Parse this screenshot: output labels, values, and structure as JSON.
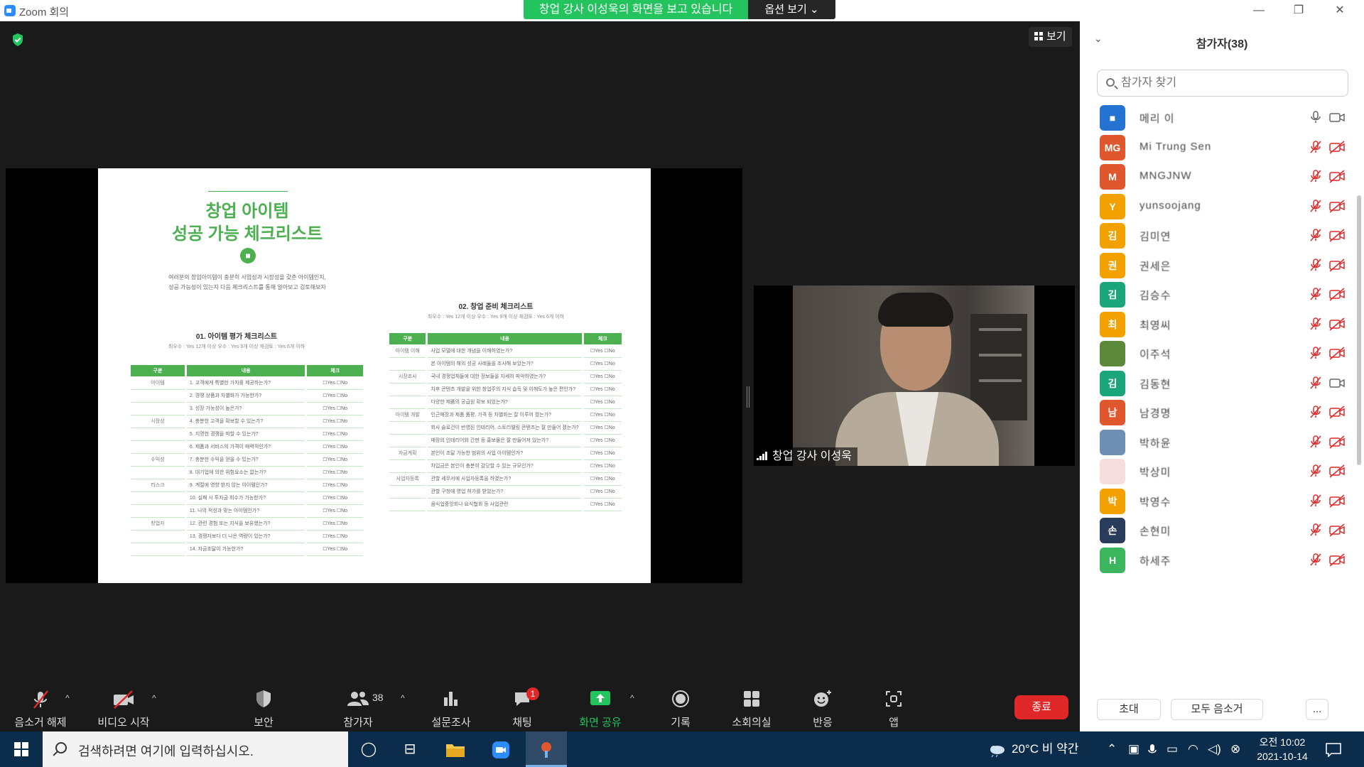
{
  "window": {
    "title": "Zoom 회의",
    "sharing_banner": "창업 강사 이성욱의 화면을 보고 있습니다",
    "options_label": "옵션 보기 ⌄",
    "minimize": "—",
    "restore": "❐",
    "close": "✕"
  },
  "view": {
    "label": "보기"
  },
  "slide": {
    "title_line1": "창업 아이템",
    "title_line2": "성공 가능 체크리스트",
    "intro_line1": "여러분의 창업아이템이 충분히 사업성과 시장성을 갖춘 아이템인지,",
    "intro_line2": "성공 가능성이 있는지 다음 체크리스트를 통해 알아보고 검토해보자",
    "section1_title": "01. 아이템 평가 체크리스트",
    "section1_sub": "최우수 : Yes 12개 이상   우수 : Yes 9개 이상   재검토 : Yes 6개 이하",
    "section2_title": "02. 창업 준비 체크리스트",
    "section2_sub": "최우수 : Yes 12개 이상   우수 : Yes 9개 이상   재검토 : Yes 6개 이하",
    "headers": [
      "구분",
      "내용",
      "체크"
    ],
    "check_text": "☐Yes  ☐No",
    "table1": [
      {
        "cat": "아이템",
        "text": "1. 고객에게 특별한 가치를 제공하는가?"
      },
      {
        "cat": "",
        "text": "2. 경쟁 상품과 차별화가 가능한가?"
      },
      {
        "cat": "",
        "text": "3. 성장 가능성이 높은가?"
      },
      {
        "cat": "시장성",
        "text": "4. 충분한 고객을 확보할 수 있는가?"
      },
      {
        "cat": "",
        "text": "5. 지명한 경쟁을 피할 수 있는가?"
      },
      {
        "cat": "",
        "text": "6. 제품과 서비스의 가격이 매력적인가?"
      },
      {
        "cat": "수익성",
        "text": "7. 충분한 수익을 얻을 수 있는가?"
      },
      {
        "cat": "",
        "text": "8. 대기업에 의한 위험요소는 없는가?"
      },
      {
        "cat": "리스크",
        "text": "9. 계절에 영향 받지 않는 아이템인가?"
      },
      {
        "cat": "",
        "text": "10. 실패 시 투자금 회수가 가능한가?"
      },
      {
        "cat": "",
        "text": "11. 나의 적성과 맞는 아이템인가?"
      },
      {
        "cat": "창업자",
        "text": "12. 관련 경험 또는 지식을 보유했는가?"
      },
      {
        "cat": "",
        "text": "13. 경쟁자보다 더 나은 역량이 있는가?"
      },
      {
        "cat": "",
        "text": "14. 자금조달이 가능한가?"
      }
    ],
    "table2": [
      {
        "cat": "아이템 이해",
        "text": "사업 모델에 대한 개념을 이해하였는가?"
      },
      {
        "cat": "",
        "text": "본 아이템의 해외 성공 사례들을 조사해 보았는가?"
      },
      {
        "cat": "시장조사",
        "text": "국내 경쟁업체들에 대한 정보들을 자세히 파악하였는가?"
      },
      {
        "cat": "",
        "text": "차후 콘텐츠 개발을 위한 창업주의 지식 습득 및 이해도가 높은 편인가?"
      },
      {
        "cat": "",
        "text": "다양한 제품의 공급원 확보 되었는가?"
      },
      {
        "cat": "아이템 개발",
        "text": "인근매장과 제품 품평, 가격 등 차별화는 잘 이루어 졌는가?"
      },
      {
        "cat": "",
        "text": "회사 슬로건이 반영된 인테리어, 스토리텔링 콘텐츠는 잘 만들어 졌는가?"
      },
      {
        "cat": "",
        "text": "매장의 인테리어와 간판 등 홍보물은 잘 만들어져 있는가?"
      },
      {
        "cat": "자금계획",
        "text": "본인이 조달 가능한 범위의 사업 아이템인가?"
      },
      {
        "cat": "",
        "text": "차입금은 본인이 충분히 감당할 수 있는 규모인가?"
      },
      {
        "cat": "사업자등록",
        "text": "관할 세무서에 사업자등록을 하였는가?"
      },
      {
        "cat": "",
        "text": "관할 구청에 영업 허가를 받았는가?"
      },
      {
        "cat": "",
        "text": "음식업중앙회나 요식협회 등 사업관련"
      }
    ]
  },
  "speaker": {
    "name": "창업 강사 이성욱"
  },
  "toolbar": {
    "mute": "음소거 해제",
    "video": "비디오 시작",
    "security": "보안",
    "participants": "참가자",
    "participants_count": "38",
    "polls": "설문조사",
    "chat": "채팅",
    "chat_badge": "1",
    "share": "화면 공유",
    "record": "기록",
    "breakout": "소회의실",
    "reactions": "반응",
    "apps": "앱",
    "end": "종료"
  },
  "panel": {
    "title": "참가자(38)",
    "search_placeholder": "참가자 찾기",
    "invite": "초대",
    "mute_all": "모두 음소거",
    "more": "...",
    "participants": [
      {
        "initial": "■",
        "name": "메리 이",
        "color": "#2472d1",
        "mic_on": true,
        "cam": "off-plain"
      },
      {
        "initial": "MG",
        "name": "Mi Trung Sen",
        "color": "#e0562d",
        "mic_on": false,
        "cam": "off"
      },
      {
        "initial": "M",
        "name": "MNGJNW",
        "color": "#e0562d",
        "mic_on": false,
        "cam": "off"
      },
      {
        "initial": "Y",
        "name": "yunsoojang",
        "color": "#f2a100",
        "mic_on": false,
        "cam": "off"
      },
      {
        "initial": "김",
        "name": "김미연",
        "color": "#f2a100",
        "mic_on": false,
        "cam": "off"
      },
      {
        "initial": "권",
        "name": "권세은",
        "color": "#f2a100",
        "mic_on": false,
        "cam": "off"
      },
      {
        "initial": "김",
        "name": "김승수",
        "color": "#1aa57b",
        "mic_on": false,
        "cam": "off"
      },
      {
        "initial": "최",
        "name": "최영씨",
        "color": "#f2a100",
        "mic_on": false,
        "cam": "off"
      },
      {
        "initial": "",
        "name": "이주석",
        "color": "#5c8a3a",
        "mic_on": false,
        "cam": "off"
      },
      {
        "initial": "김",
        "name": "김동현",
        "color": "#1aa57b",
        "mic_on": false,
        "cam": "off-plain"
      },
      {
        "initial": "남",
        "name": "남경명",
        "color": "#e0562d",
        "mic_on": false,
        "cam": "off"
      },
      {
        "initial": "",
        "name": "박하윤",
        "color": "#6f8fb3",
        "mic_on": false,
        "cam": "off"
      },
      {
        "initial": "",
        "name": "박상미",
        "color": "#f6dede",
        "mic_on": false,
        "cam": "off"
      },
      {
        "initial": "박",
        "name": "박영수",
        "color": "#f2a100",
        "mic_on": false,
        "cam": "off"
      },
      {
        "initial": "손",
        "name": "손현미",
        "color": "#2a3c5c",
        "mic_on": false,
        "cam": "off"
      },
      {
        "initial": "H",
        "name": "하세주",
        "color": "#3bb55e",
        "mic_on": false,
        "cam": "off"
      }
    ]
  },
  "taskbar": {
    "search_placeholder": "검색하려면 여기에 입력하십시오.",
    "weather": "20°C  비 약간",
    "time": "오전 10:02",
    "date": "2021-10-14"
  },
  "colors": {
    "accent_green": "#23c45e",
    "end_red": "#e02828",
    "slide_green": "#4caf50",
    "taskbar": "#0b2c4a"
  }
}
